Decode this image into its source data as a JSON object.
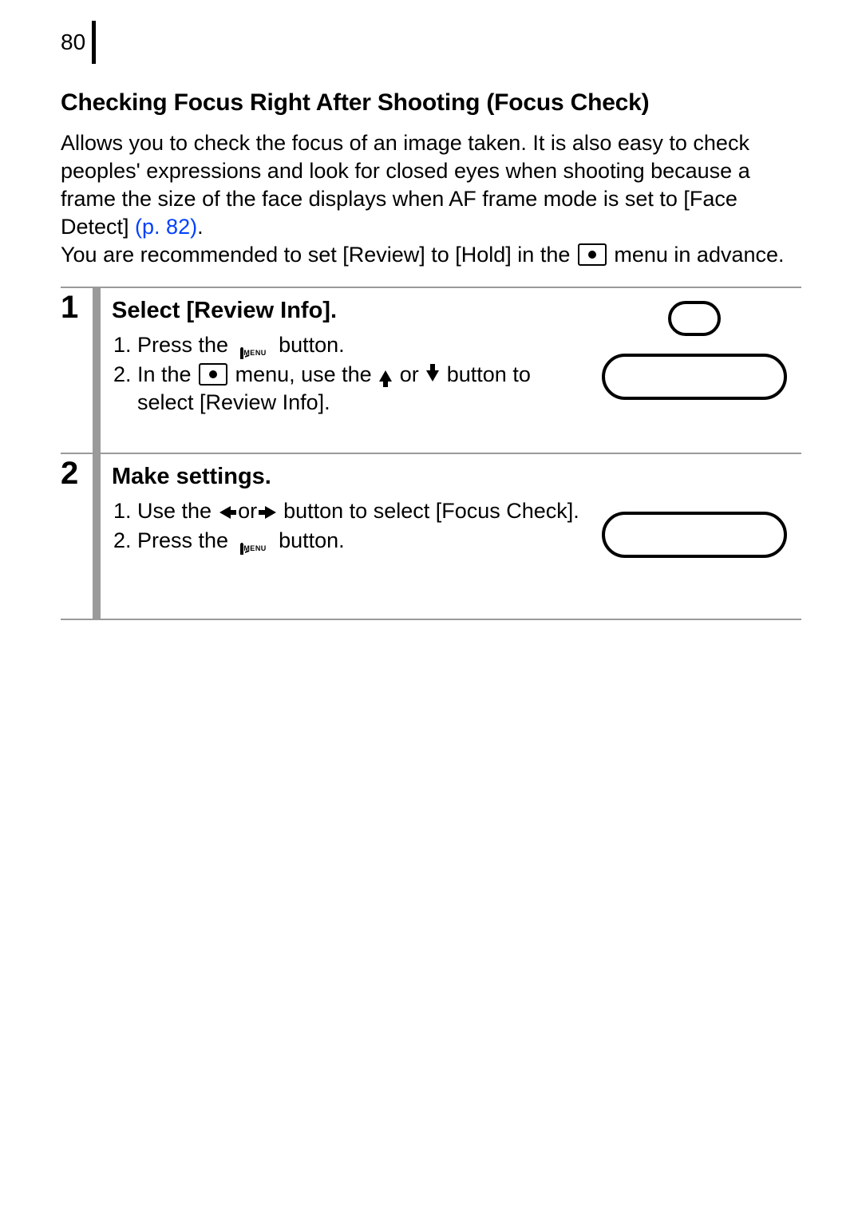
{
  "page_number": "80",
  "heading": "Checking Focus Right After Shooting (Focus Check)",
  "intro": {
    "p1a": "Allows you to check the focus of an image taken. It is also easy to check peoples' expressions and look for closed eyes when shooting because a frame the size of the face displays when AF frame mode is set to [Face Detect] ",
    "page_ref": "(p. 82)",
    "p1b": ".",
    "p2a": "You are recommended to set [Review] to [Hold] in the ",
    "p2b": " menu in advance."
  },
  "steps": [
    {
      "num": "1",
      "title": "Select [Review Info].",
      "items": [
        {
          "pre": "Press the ",
          "icon": "menu",
          "post": " button."
        },
        {
          "pre": "In the ",
          "icon": "camera",
          "mid": " menu, use the ",
          "or": " or ",
          "post": " button to select [Review Info]."
        }
      ]
    },
    {
      "num": "2",
      "title": "Make settings.",
      "items": [
        {
          "pre": "Use the ",
          "or": " or ",
          "post": " button to select [Focus Check]."
        },
        {
          "pre": "Press the ",
          "icon": "menu",
          "post": " button."
        }
      ]
    }
  ],
  "icons": {
    "menu_label": "MENU"
  }
}
